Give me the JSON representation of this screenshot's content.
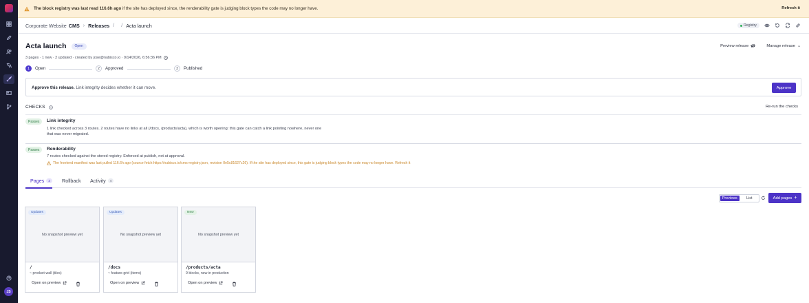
{
  "banner": {
    "bold": "The block registry was last read 116.6h ago",
    "text": " if the site has deployed since, the renderability gate is judging block types the code may no longer have.",
    "refresh_label": "Refresh it"
  },
  "breadcrumb": {
    "site": "Corporate Website",
    "app": "CMS",
    "releases": "Releases",
    "slash": "/",
    "current": "Acta launch"
  },
  "header": {
    "registry_label": "Registry"
  },
  "release": {
    "title": "Acta launch",
    "status": "Open",
    "meta": "3 pages · 1 new · 2 updated · created by jose@nubisco.io · 9/14/2026, 6:56:36 PM",
    "preview_label": "Preview release",
    "manage_label": "Manage release"
  },
  "stepper": [
    {
      "num": "1",
      "label": "Open"
    },
    {
      "num": "2",
      "label": "Approved"
    },
    {
      "num": "3",
      "label": "Published"
    }
  ],
  "approve": {
    "bold": "Approve this release.",
    "text": " Link integrity decides whether it can move.",
    "button": "Approve"
  },
  "checks": {
    "title": "CHECKS",
    "rerun_label": "Re-run the checks",
    "items": [
      {
        "status": "Passes",
        "name": "Link integrity",
        "desc": "1 link checked across 3 routes. 2 routes have no links at all (/docs, /products/acta), which is worth opening: this gate can catch a link pointing nowhere, never one that was never migrated.",
        "warning": ""
      },
      {
        "status": "Passes",
        "name": "Renderability",
        "desc": "7 routes checked against the stored registry. Enforced at publish, not at approval.",
        "warning": "The frontend manifest was last pulled 116.6h ago (source fetch:https://nubisco.io/cms-registry.json, revision 0e5c81627c26). If the site has deployed since, this gate is judging block types the code may no longer have. Refresh it"
      }
    ]
  },
  "tabs": [
    {
      "label": "Pages",
      "count": "3"
    },
    {
      "label": "Rollback",
      "count": ""
    },
    {
      "label": "Activity",
      "count": "4"
    }
  ],
  "view": {
    "previews_label": "Previews",
    "list_label": "List",
    "add_pages_label": "Add pages"
  },
  "cards": [
    {
      "tag": "Updates",
      "placeholder": "No snapshot preview yet",
      "path": "/",
      "sub": "~ product-wall (tiles)",
      "open_label": "Open on preview"
    },
    {
      "tag": "Updates",
      "placeholder": "No snapshot preview yet",
      "path": "/docs",
      "sub": "~ feature-grid (items)",
      "open_label": "Open on preview"
    },
    {
      "tag": "New",
      "placeholder": "No snapshot preview yet",
      "path": "/products/acta",
      "sub": "9 blocks, new in production",
      "open_label": "Open on preview"
    }
  ],
  "user": {
    "initials": "JS"
  },
  "colors": {
    "accent": "#4c33c7",
    "rail": "#181a2e",
    "banner": "#fdf0d8",
    "pass": "#2f7d45",
    "warning": "#c9872a"
  }
}
